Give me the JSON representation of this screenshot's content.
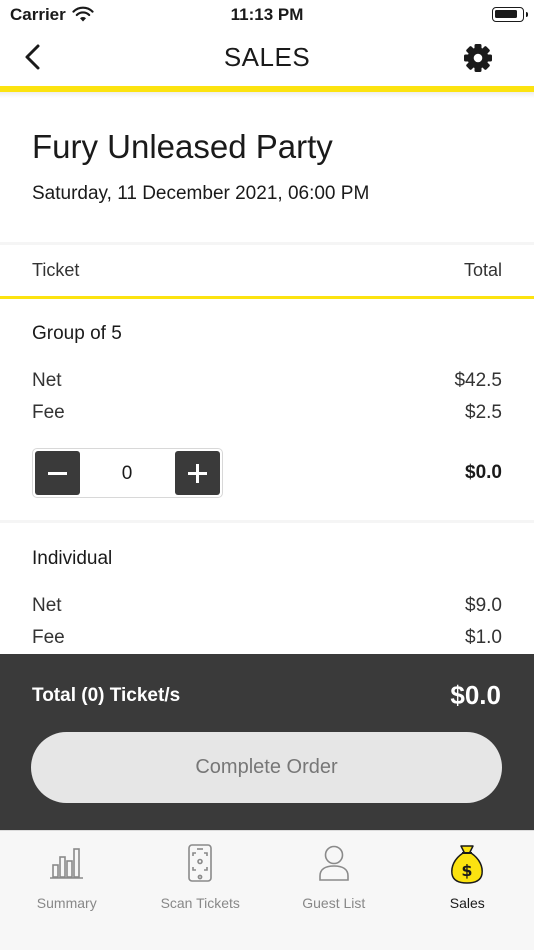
{
  "status_bar": {
    "carrier": "Carrier",
    "time": "11:13 PM"
  },
  "header": {
    "title": "SALES",
    "back_icon": "chevron-left-icon",
    "settings_icon": "gear-icon"
  },
  "event": {
    "title": "Fury Unleased Party",
    "date": "Saturday, 11 December 2021, 06:00 PM"
  },
  "columns": {
    "ticket": "Ticket",
    "total": "Total"
  },
  "tickets": [
    {
      "name": "Group of 5",
      "net_label": "Net",
      "net": "$42.5",
      "fee_label": "Fee",
      "fee": "$2.5",
      "quantity": "0",
      "line_total": "$0.0"
    },
    {
      "name": "Individual",
      "net_label": "Net",
      "net": "$9.0",
      "fee_label": "Fee",
      "fee": "$1.0"
    }
  ],
  "footer": {
    "total_label": "Total (0) Ticket/s",
    "total_amount": "$0.0",
    "complete_label": "Complete Order"
  },
  "tabs": [
    {
      "label": "Summary",
      "icon": "bar-chart-icon",
      "active": false
    },
    {
      "label": "Scan Tickets",
      "icon": "phone-scan-icon",
      "active": false
    },
    {
      "label": "Guest List",
      "icon": "person-icon",
      "active": false
    },
    {
      "label": "Sales",
      "icon": "money-bag-icon",
      "active": true
    }
  ],
  "colors": {
    "accent": "#fce310",
    "dark_panel": "#3a3a3a",
    "button_bg": "#e6e6e6"
  }
}
